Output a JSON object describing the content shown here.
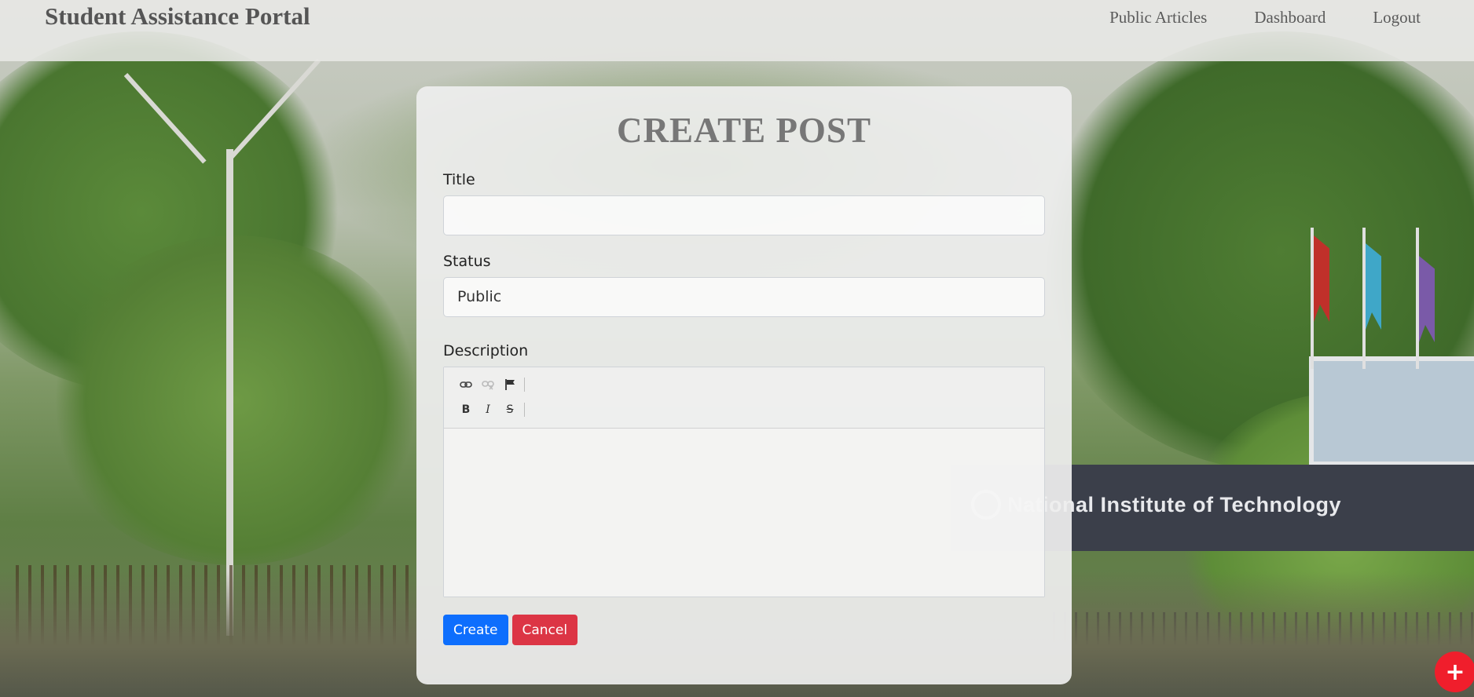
{
  "navbar": {
    "brand": "Student Assistance Portal",
    "links": [
      "Public Articles",
      "Dashboard",
      "Logout"
    ]
  },
  "background": {
    "sign_text": "National Institute of Technology"
  },
  "form": {
    "heading": "CREATE POST",
    "title_label": "Title",
    "title_value": "",
    "status_label": "Status",
    "status_value": "Public",
    "description_label": "Description",
    "description_value": "",
    "toolbar": {
      "row1": [
        "link-icon",
        "unlink-icon",
        "anchor-flag-icon"
      ],
      "row2": [
        "B",
        "I",
        "S"
      ]
    },
    "create_button": "Create",
    "cancel_button": "Cancel"
  },
  "fab": {
    "label": "+",
    "color": "#f01e2c"
  },
  "colors": {
    "primary": "#0d6efd",
    "danger": "#dc3545"
  }
}
